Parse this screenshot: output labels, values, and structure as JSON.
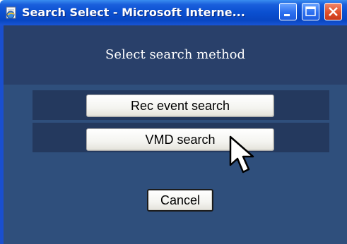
{
  "window": {
    "title": "Search Select - Microsoft Interne..."
  },
  "dialog": {
    "header": "Select search method",
    "buttons": {
      "rec_event_search": "Rec event search",
      "vmd_search": "VMD search",
      "cancel": "Cancel"
    }
  },
  "icons": {
    "app": "internet-explorer-page-icon",
    "minimize": "minimize-icon",
    "maximize": "maximize-icon",
    "close": "close-icon",
    "cursor": "arrow-cursor-icon"
  },
  "colors": {
    "titlebar": "#0a4fd0",
    "dialog_background": "#2f4f7c",
    "header_background": "#29406a",
    "button_row_background": "#24395e",
    "close_button": "#e0502a"
  }
}
